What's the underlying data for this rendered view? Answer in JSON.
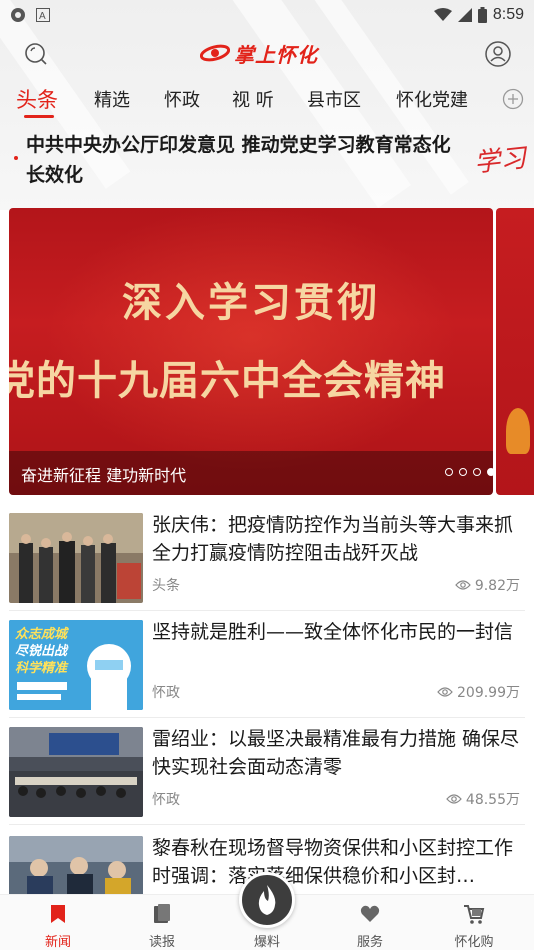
{
  "status_bar": {
    "time": "8:59"
  },
  "header": {
    "logo_text": "掌上怀化"
  },
  "tabs": [
    {
      "label": "头条",
      "active": true
    },
    {
      "label": "精选"
    },
    {
      "label": "怀政"
    },
    {
      "label": "视 听"
    },
    {
      "label": "县市区"
    },
    {
      "label": "怀化党建"
    }
  ],
  "headline": {
    "text": "中共中央办公厅印发意见 推动党史学习教育常态化长效化",
    "badge": "学习"
  },
  "banner": {
    "line1": "深入学习贯彻",
    "line2": "党的十九届六中全会精神",
    "caption": "奋进新征程 建功新时代",
    "dot_count": 5,
    "active_dot": 4
  },
  "news": [
    {
      "title": "张庆伟：把疫情防控作为当前头等大事来抓 全力打赢疫情防控阻击战歼灭战",
      "source": "头条",
      "views": "9.82万"
    },
    {
      "title": "坚持就是胜利——致全体怀化市民的一封信",
      "source": "怀政",
      "views": "209.99万",
      "thumb_text": [
        "众志成城",
        "尽锐出战",
        "科学精准"
      ]
    },
    {
      "title": "雷绍业：以最坚决最精准最有力措施 确保尽快实现社会面动态清零",
      "source": "怀政",
      "views": "48.55万"
    },
    {
      "title": "黎春秋在现场督导物资保供和小区封控工作时强调：落实落细保供稳价和小区封…"
    }
  ],
  "bottom_nav": [
    {
      "label": "新闻",
      "active": true
    },
    {
      "label": "读报"
    },
    {
      "label": "爆料"
    },
    {
      "label": "服务"
    },
    {
      "label": "怀化购"
    }
  ],
  "colors": {
    "accent": "#e2231a",
    "banner_red": "#c61d20",
    "banner_text": "#f6d6a2"
  }
}
